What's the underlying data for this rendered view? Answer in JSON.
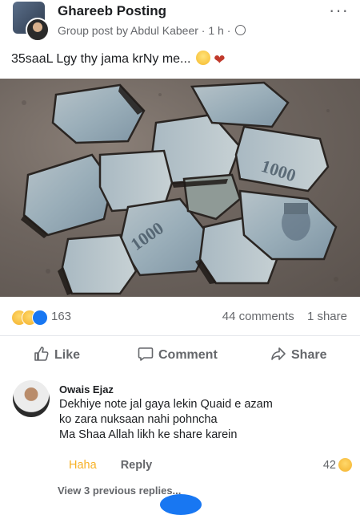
{
  "post": {
    "group_name": "Ghareeb Posting",
    "subtitle": "Group post by Abdul Kabeer · 1 h ·",
    "more_label": "···",
    "caption": "35saaL Lgy thy jama krNy me..."
  },
  "reactions": {
    "count": "163",
    "types": [
      "sad-reaction-icon",
      "haha-reaction-icon",
      "like-reaction-icon"
    ],
    "comments": "44 comments",
    "shares": "1 share"
  },
  "actions": {
    "like": "Like",
    "comment": "Comment",
    "share": "Share"
  },
  "comment": {
    "author": "Owais Ejaz",
    "lines": [
      "Dekhiye note jal gaya lekin Quaid e azam",
      "ko zara nuksaan nahi pohncha",
      "Ma Shaa Allah likh ke share karein"
    ],
    "haha_label": "Haha",
    "reply_label": "Reply",
    "reaction_count": "42"
  },
  "view_replies": "View 3 previous replies...",
  "colors": {
    "brand_blue": "#1877f2",
    "secondary_text": "#65676b",
    "haha_yellow": "#f7b125"
  }
}
